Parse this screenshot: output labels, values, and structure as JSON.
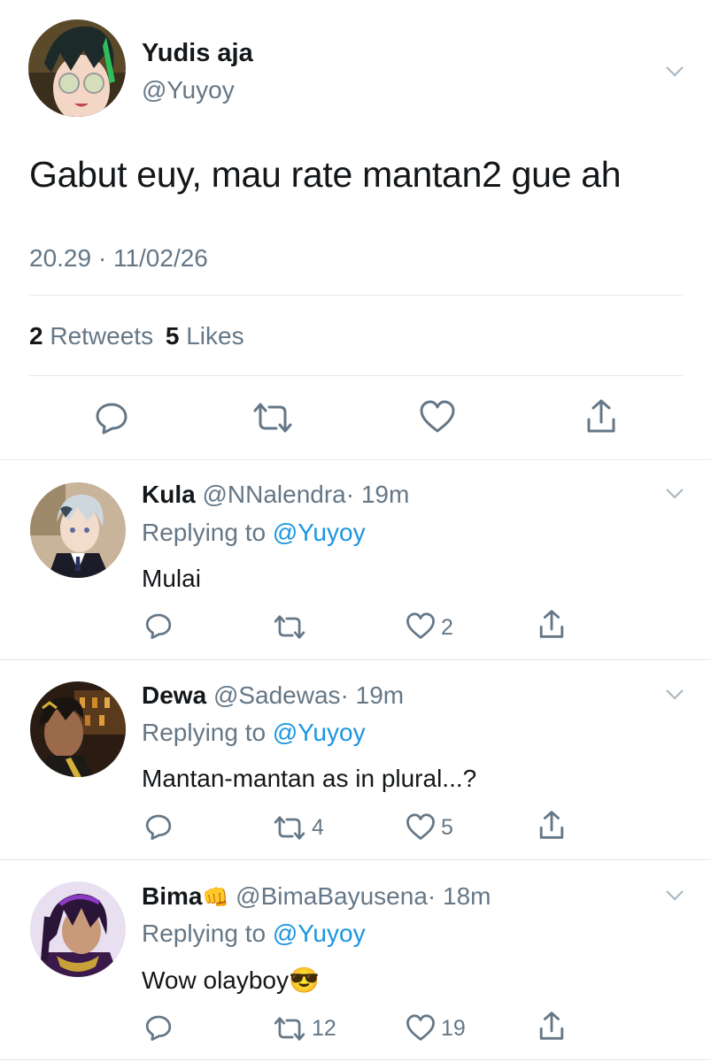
{
  "main_tweet": {
    "display_name": "Yudis aja",
    "handle": "@Yuyoy",
    "text": "Gabut euy, mau rate mantan2 gue ah",
    "timestamp": "20.29 · 11/02/26",
    "retweets_count": "2",
    "retweets_label": "Retweets",
    "likes_count": "5",
    "likes_label": "Likes"
  },
  "replies": [
    {
      "display_name": "Kula",
      "handle": "@NNalendra",
      "time": "· 19m",
      "replying_label": "Replying to",
      "replying_to": "@Yuyoy",
      "text": "Mulai",
      "retweets": "",
      "likes": "2"
    },
    {
      "display_name": "Dewa",
      "handle": "@Sadewas",
      "time": "· 19m",
      "replying_label": "Replying to",
      "replying_to": "@Yuyoy",
      "text": "Mantan-mantan as in plural...?",
      "retweets": "4",
      "likes": "5"
    },
    {
      "display_name": "Bima",
      "name_emoji": "👊",
      "handle": "@BimaBayusena",
      "time": "· 18m",
      "replying_label": "Replying to",
      "replying_to": "@Yuyoy",
      "text": "Wow olayboy",
      "text_emoji": "😎",
      "retweets": "12",
      "likes": "19"
    }
  ],
  "icons": {
    "reply": "speech-bubble",
    "retweet": "retweet-arrows",
    "like": "heart-outline",
    "share": "share-arrow-up",
    "menu": "chevron-down"
  },
  "colors": {
    "link_blue": "#1b95e0",
    "secondary_gray": "#657786",
    "divider": "#e1e8ed"
  }
}
